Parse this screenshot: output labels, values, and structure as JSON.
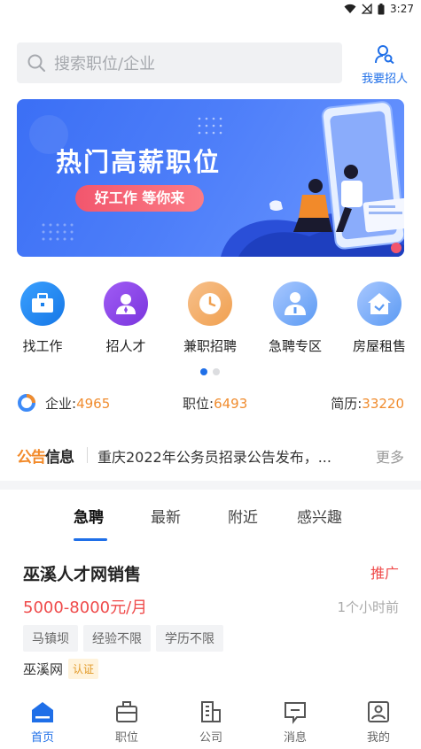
{
  "status_bar": {
    "time": "3:27",
    "icons": [
      "wifi-icon",
      "signal-off-icon",
      "battery-icon"
    ]
  },
  "search": {
    "placeholder": "搜索职位/企业",
    "icon": "search-icon"
  },
  "recruit_button": {
    "label": "我要招人",
    "icon": "person-search-icon"
  },
  "banner": {
    "title": "热门高薪职位",
    "pill": "好工作 等你来"
  },
  "menu": [
    {
      "label": "找工作",
      "icon": "briefcase-icon",
      "color": "#1f8ef1"
    },
    {
      "label": "招人才",
      "icon": "person-tie-icon",
      "color": "#8b48e8"
    },
    {
      "label": "兼职招聘",
      "icon": "clock-icon",
      "color": "#f2a34d"
    },
    {
      "label": "急聘专区",
      "icon": "person-info-icon",
      "color": "#5b9af3"
    },
    {
      "label": "房屋租售",
      "icon": "house-icon",
      "color": "#5b9af3"
    }
  ],
  "pager": {
    "pages": 2,
    "current": 1
  },
  "stats": {
    "company_label": "企业:",
    "company_value": "4965",
    "job_label": "职位:",
    "job_value": "6493",
    "resume_label": "简历:",
    "resume_value": "33220"
  },
  "notice": {
    "logo_part1": "公告",
    "logo_part2": "信息",
    "text": "重庆2022年公务员招录公告发布，...",
    "more": "更多"
  },
  "tabs": [
    {
      "label": "急聘",
      "active": true
    },
    {
      "label": "最新",
      "active": false
    },
    {
      "label": "附近",
      "active": false
    },
    {
      "label": "感兴趣",
      "active": false
    }
  ],
  "job": {
    "title": "巫溪人才网销售",
    "promo": "推广",
    "salary": "5000-8000元/月",
    "time": "1个小时前",
    "tags": [
      "马镇坝",
      "经验不限",
      "学历不限"
    ],
    "company": "巫溪网",
    "cert": "认证"
  },
  "bottom_nav": [
    {
      "label": "首页",
      "icon": "home-icon",
      "active": true
    },
    {
      "label": "职位",
      "icon": "briefcase-icon",
      "active": false
    },
    {
      "label": "公司",
      "icon": "building-icon",
      "active": false
    },
    {
      "label": "消息",
      "icon": "message-icon",
      "active": false
    },
    {
      "label": "我的",
      "icon": "profile-icon",
      "active": false
    }
  ],
  "colors": {
    "accent": "#1f6fe8",
    "orange": "#f08c2e",
    "red": "#ef4a4a"
  }
}
